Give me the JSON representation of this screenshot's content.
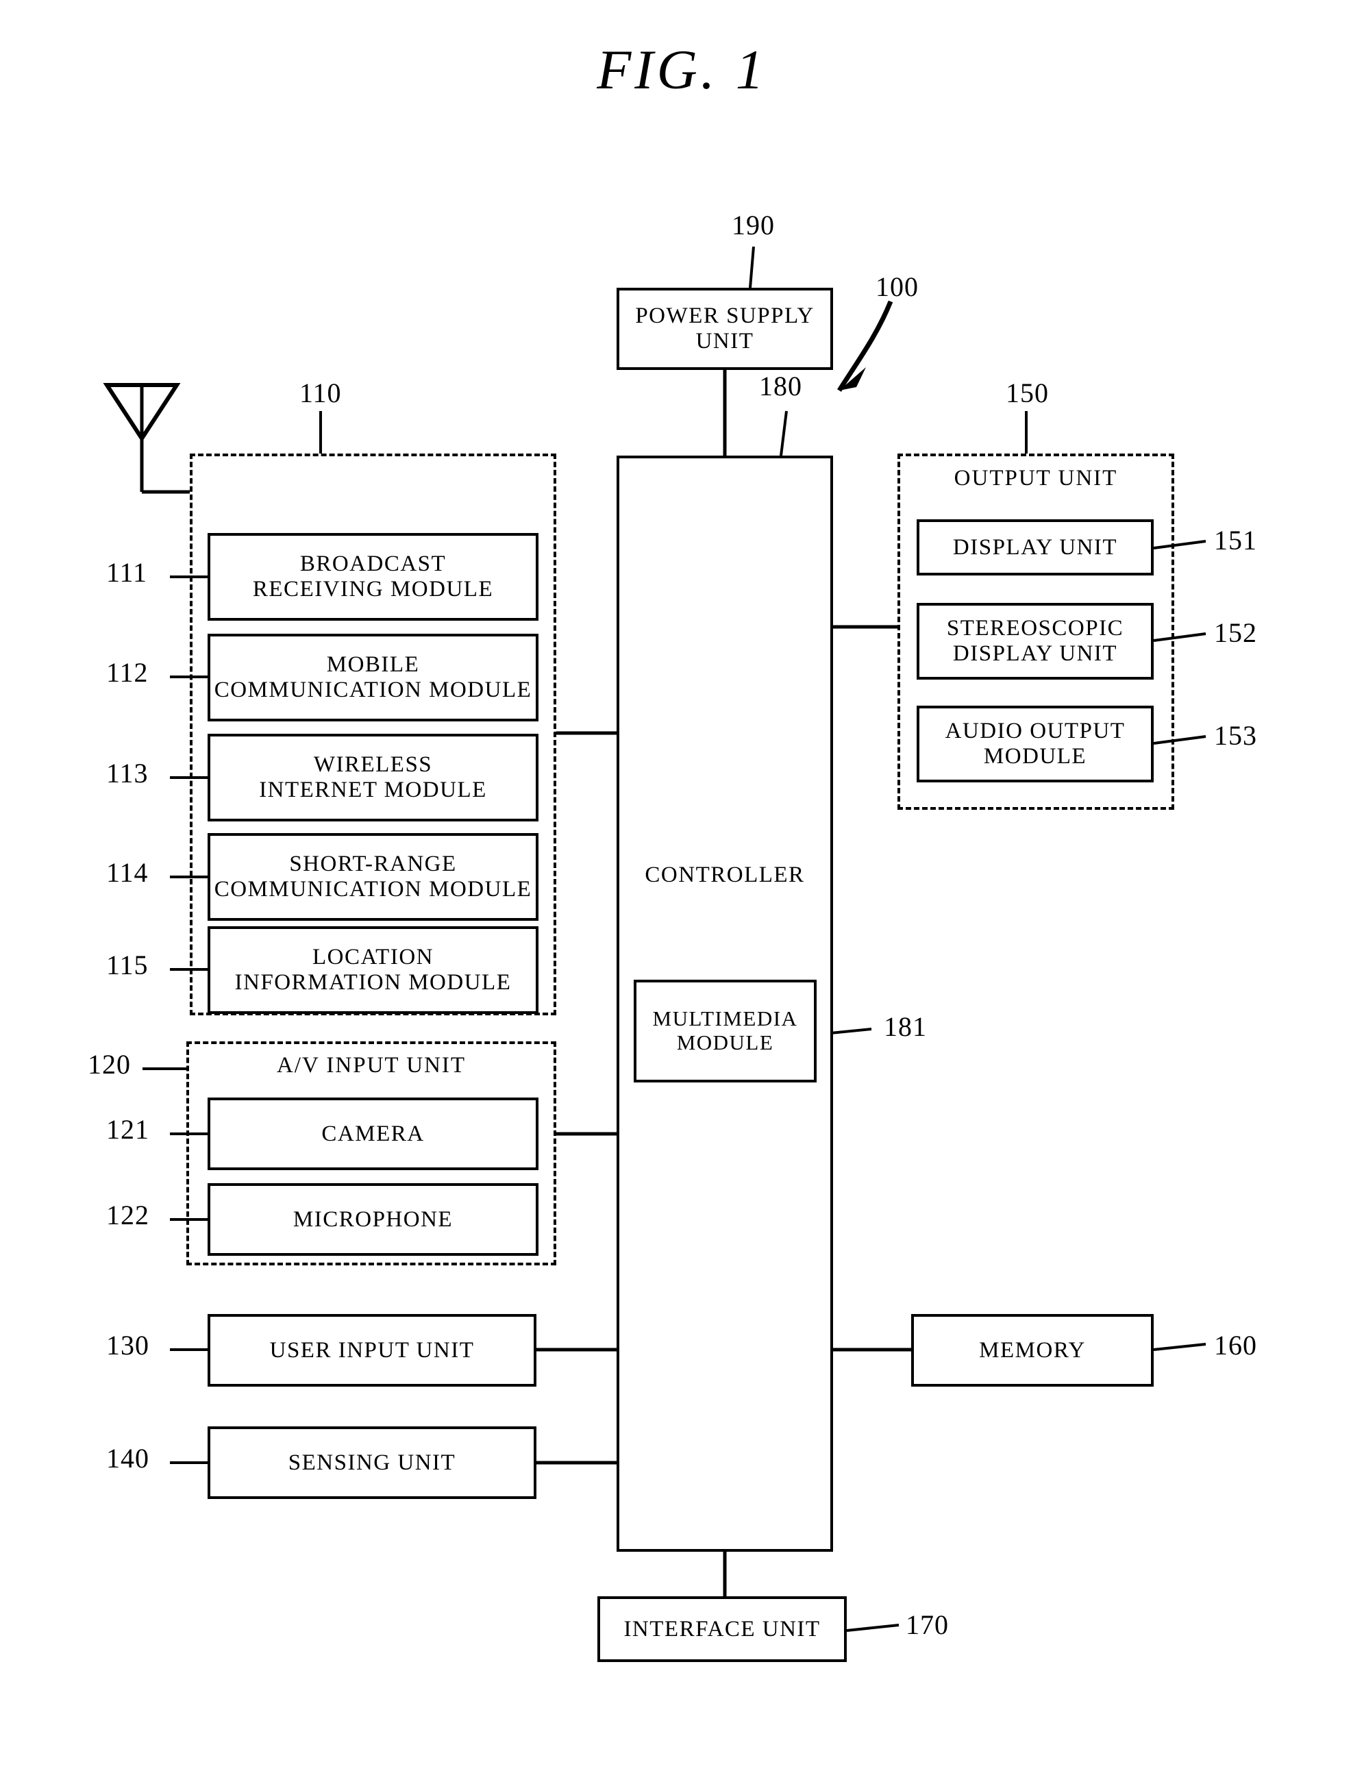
{
  "figure": {
    "title": "FIG.  1",
    "system_ref": "100"
  },
  "power_supply": {
    "label": "POWER SUPPLY\nUNIT",
    "ref": "190"
  },
  "controller": {
    "label": "CONTROLLER",
    "ref": "180",
    "multimedia_module": {
      "label": "MULTIMEDIA\nMODULE",
      "ref": "181"
    }
  },
  "wireless_communication_unit": {
    "ref": "110",
    "antenna": "antenna-icon",
    "modules": [
      {
        "label": "BROADCAST\nRECEIVING MODULE",
        "ref": "111"
      },
      {
        "label": "MOBILE\nCOMMUNICATION MODULE",
        "ref": "112"
      },
      {
        "label": "WIRELESS\nINTERNET MODULE",
        "ref": "113"
      },
      {
        "label": "SHORT-RANGE\nCOMMUNICATION MODULE",
        "ref": "114"
      },
      {
        "label": "LOCATION\nINFORMATION MODULE",
        "ref": "115"
      }
    ]
  },
  "av_input_unit": {
    "caption": "A/V INPUT UNIT",
    "ref": "120",
    "modules": [
      {
        "label": "CAMERA",
        "ref": "121"
      },
      {
        "label": "MICROPHONE",
        "ref": "122"
      }
    ]
  },
  "user_input_unit": {
    "label": "USER INPUT UNIT",
    "ref": "130"
  },
  "sensing_unit": {
    "label": "SENSING UNIT",
    "ref": "140"
  },
  "output_unit": {
    "caption": "OUTPUT UNIT",
    "ref": "150",
    "modules": [
      {
        "label": "DISPLAY UNIT",
        "ref": "151"
      },
      {
        "label": "STEREOSCOPIC\nDISPLAY UNIT",
        "ref": "152"
      },
      {
        "label": "AUDIO OUTPUT\nMODULE",
        "ref": "153"
      }
    ]
  },
  "memory": {
    "label": "MEMORY",
    "ref": "160"
  },
  "interface_unit": {
    "label": "INTERFACE UNIT",
    "ref": "170"
  },
  "colors": {
    "ink": "#000000",
    "paper": "#ffffff"
  }
}
